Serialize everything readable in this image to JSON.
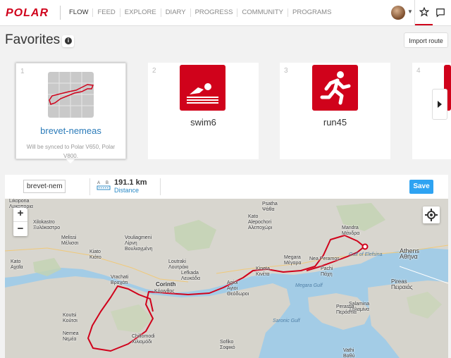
{
  "brand": {
    "logo": "POLAR",
    "accent": "#d0021b"
  },
  "nav": {
    "items": [
      "FLOW",
      "FEED",
      "EXPLORE",
      "DIARY",
      "PROGRESS",
      "COMMUNITY",
      "PROGRAMS"
    ],
    "active": "FLOW"
  },
  "header": {
    "title": "Favorites",
    "import_label": "Import route"
  },
  "cards": [
    {
      "num": "1",
      "label": "brevet-nemeas",
      "sub": "Will be synced to Polar V650, Polar V800.",
      "icon": "route-thumbnail"
    },
    {
      "num": "2",
      "label": "swim6",
      "icon": "swimming-icon"
    },
    {
      "num": "3",
      "label": "run45",
      "icon": "running-icon"
    },
    {
      "num": "4",
      "icon": "partial-card"
    }
  ],
  "route": {
    "name": "brevet-nemeas",
    "distance": "191.1 km",
    "distance_label": "Distance",
    "save_label": "Save",
    "a": "A",
    "b": "B"
  },
  "map": {
    "zoom_in": "+",
    "zoom_out": "−",
    "labels": {
      "likoporia": "Likoporia\nΛυκοπορια",
      "xilokastro": "Xilokastro\nΞυλόκαστρο",
      "melissi": "Melissi\nΜέλισσι",
      "kiato": "Kiato\nΚιάτο",
      "lirni": "Vouliagmeni\nΛίρνη\nΒουλιαγμένη",
      "loutraki": "Loutraki\nΛουτράκι",
      "corinth": "Corinth",
      "korinthos": "Κόρινθος",
      "vrachati": "Vrachati\nΒραχάτι",
      "nemea": "Nemea\nΝεμέα",
      "koutsi": "Koutsi\nΚούτσι",
      "chiliomodi": "Chiliomodi\nΧιλιομόδι",
      "agioi": "Agioi\nΑγιοι\nΘεόδωροι",
      "alepochori": "Kato\nAlepochori\nΑλεποχώρι",
      "psatha": "Psatha\nΨάθα",
      "mandra": "Mandra\nΜάνδρα",
      "nea_peramos": "Nea Peramos",
      "pachi": "Pachi\nΠάχη",
      "megara_gulf": "Megara Gulf",
      "elefsina_gulf": "Gulf of Elefsina",
      "salamina": "Salamina\nΣαλαμίνα",
      "perastia": "Perastia\nΠεράστια",
      "pireas": "Pireas\nΠειραιάς",
      "athens": "Athens\nΑθήνα",
      "vathi": "Vathi\nΒαθύ",
      "saronic": "Saronic Gulf",
      "sofiko": "Sofiko\nΣοφικό",
      "kineta": "Kineta\nΚινέτα",
      "kato_achaia": "Kato\nΑχαΐα",
      "lefkada": "Lefkada\nΛευκάδα",
      "megara": "Megara\nΜέγαρα"
    }
  }
}
